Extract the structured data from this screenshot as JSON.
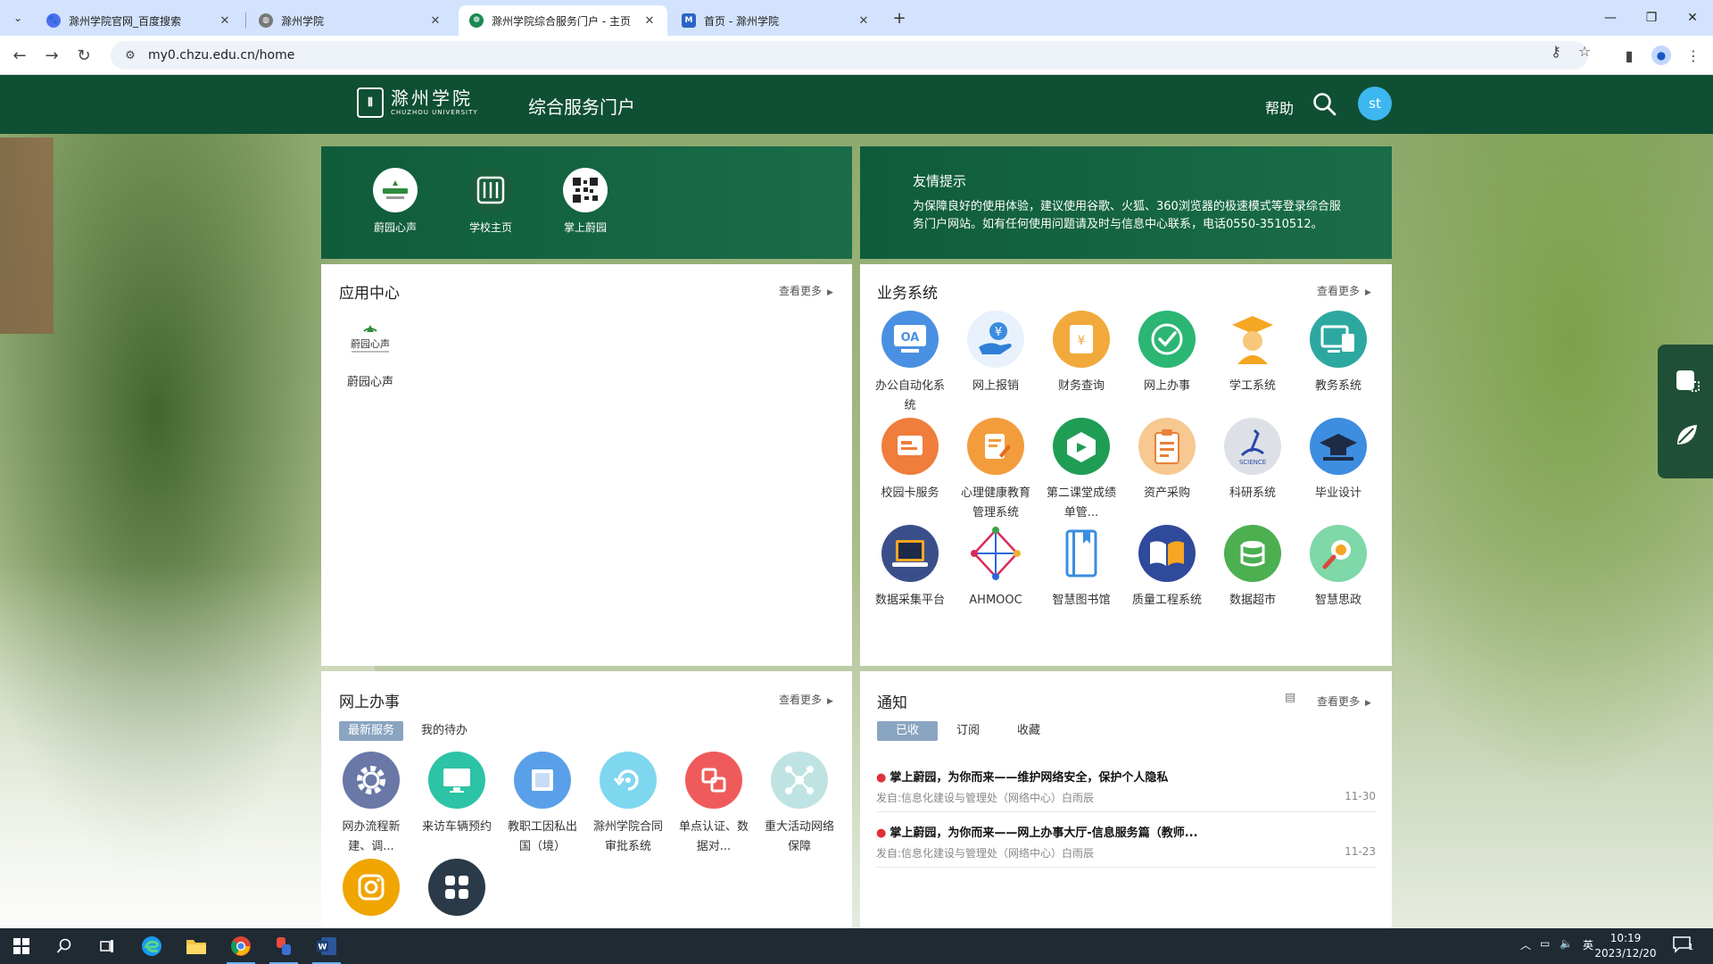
{
  "browser": {
    "tabs": [
      {
        "title": "滁州学院官网_百度搜索",
        "active": false
      },
      {
        "title": "滁州学院",
        "active": false
      },
      {
        "title": "滁州学院综合服务门户 - 主页",
        "active": true
      },
      {
        "title": "首页 - 滁州学院",
        "active": false
      }
    ],
    "url": "my0.chzu.edu.cn/home"
  },
  "header": {
    "logo_cn": "滁州学院",
    "logo_en": "CHUZHOU UNIVERSITY",
    "title": "综合服务门户",
    "help": "帮助",
    "avatar": "st"
  },
  "quick_links": [
    {
      "label": "蔚园心声",
      "icon": "weiyuan-icon"
    },
    {
      "label": "学校主页",
      "icon": "school-logo-icon"
    },
    {
      "label": "掌上蔚园",
      "icon": "qr-code-icon"
    }
  ],
  "tips": {
    "title": "友情提示",
    "text": "为保障良好的使用体验，建议使用谷歌、火狐、360浏览器的极速模式等登录综合服务门户网站。如有任何使用问题请及时与信息中心联系，电话0550-3510512。"
  },
  "app_center": {
    "title": "应用中心",
    "more": "查看更多",
    "items": [
      {
        "label": "蔚园心声",
        "logo_text": "蔚园心声"
      }
    ]
  },
  "business": {
    "title": "业务系统",
    "more": "查看更多",
    "items": [
      {
        "label": "办公自动化系统",
        "icon": "oa-icon",
        "color": "#4a90e2"
      },
      {
        "label": "网上报销",
        "icon": "reimburse-icon",
        "color": "#2f7fd8"
      },
      {
        "label": "财务查询",
        "icon": "finance-icon",
        "color": "#f2a93b"
      },
      {
        "label": "网上办事",
        "icon": "check-icon",
        "color": "#2bb673"
      },
      {
        "label": "学工系统",
        "icon": "graduate-icon",
        "color": "#f5a623"
      },
      {
        "label": "教务系统",
        "icon": "devices-icon",
        "color": "#2da8a0"
      },
      {
        "label": "校园卡服务",
        "icon": "card-icon",
        "color": "#ef7d3c"
      },
      {
        "label": "心理健康教育管理系统",
        "icon": "edit-icon",
        "color": "#f39c3c"
      },
      {
        "label": "第二课堂成绩单管...",
        "icon": "cube-icon",
        "color": "#1f9d55"
      },
      {
        "label": "资产采购",
        "icon": "clipboard-icon",
        "color": "#f0a050"
      },
      {
        "label": "科研系统",
        "icon": "science-icon",
        "color": "#c8ccd4"
      },
      {
        "label": "毕业设计",
        "icon": "cap-icon",
        "color": "#3d8de0"
      },
      {
        "label": "数据采集平台",
        "icon": "laptop-icon",
        "color": "#3a4f8a"
      },
      {
        "label": "AHMOOC",
        "icon": "mooc-icon",
        "color": "#ffffff"
      },
      {
        "label": "智慧图书馆",
        "icon": "book-icon",
        "color": "#ffffff"
      },
      {
        "label": "质量工程系统",
        "icon": "open-book-icon",
        "color": "#2f4a9a"
      },
      {
        "label": "数据超市",
        "icon": "database-icon",
        "color": "#4caf50"
      },
      {
        "label": "智慧思政",
        "icon": "magnifier-icon",
        "color": "#7ed8a8"
      }
    ]
  },
  "online": {
    "title": "网上办事",
    "more": "查看更多",
    "tabs": [
      "最新服务",
      "我的待办"
    ],
    "items": [
      {
        "label": "网办流程新建、调...",
        "icon": "gear-icon",
        "color": "#6a78a8"
      },
      {
        "label": "来访车辆预约",
        "icon": "monitor-icon",
        "color": "#2cc3a6"
      },
      {
        "label": "教职工因私出国（境）",
        "icon": "screen-icon",
        "color": "#5aa0e8"
      },
      {
        "label": "滁州学院合同审批系统",
        "icon": "refresh-icon",
        "color": "#7fd6ef"
      },
      {
        "label": "单点认证、数据对...",
        "icon": "link-icon",
        "color": "#ef5b5b"
      },
      {
        "label": "重大活动网络保障",
        "icon": "network-icon",
        "color": "#bfe3e3"
      },
      {
        "label": "",
        "icon": "instagram-icon",
        "color": "#f0a500"
      },
      {
        "label": "",
        "icon": "grid-icon",
        "color": "#2b3a48"
      }
    ]
  },
  "notices": {
    "title": "通知",
    "more": "查看更多",
    "tabs": [
      "已收",
      "订阅",
      "收藏"
    ],
    "items": [
      {
        "title": "掌上蔚园，为你而来——维护网络安全，保护个人隐私",
        "from": "发自:信息化建设与管理处（网络中心）白雨辰",
        "date": "11-30"
      },
      {
        "title": "掌上蔚园，为你而来——网上办事大厅-信息服务篇（教师...",
        "from": "发自:信息化建设与管理处（网络中心）白雨辰",
        "date": "11-23"
      }
    ]
  },
  "taskbar": {
    "ime": "英",
    "time": "10:19",
    "date": "2023/12/20",
    "notifications": "1"
  }
}
